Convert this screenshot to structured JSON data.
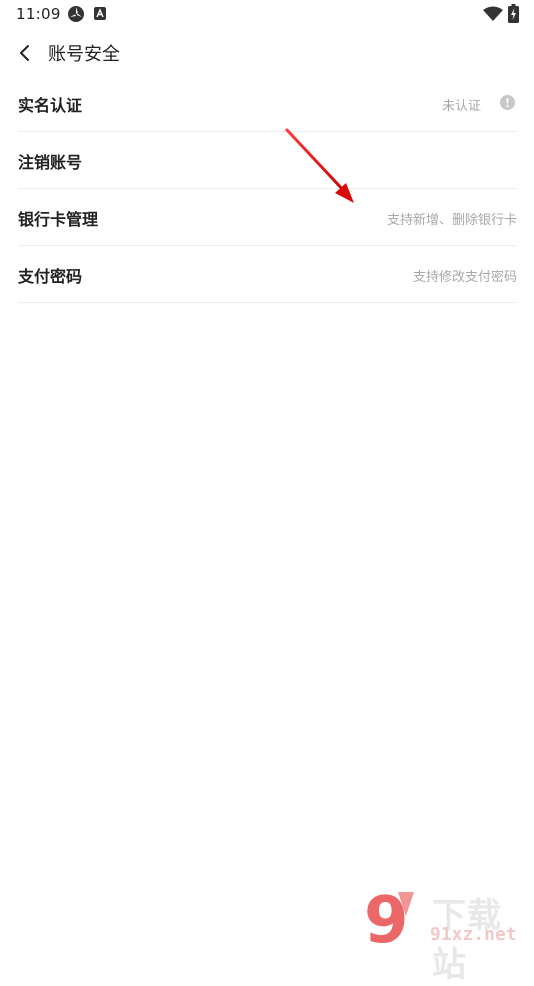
{
  "status_bar": {
    "time": "11:09",
    "icons": [
      "radar-icon",
      "a-notification-icon",
      "wifi-icon",
      "battery-charging-icon"
    ]
  },
  "nav": {
    "back_icon": "chevron-left-icon",
    "title": "账号安全"
  },
  "menu": [
    {
      "label": "实名认证",
      "hint": "未认证",
      "icon": "info-circle-icon"
    },
    {
      "label": "注销账号",
      "hint": ""
    },
    {
      "label": "银行卡管理",
      "hint": "支持新增、删除银行卡"
    },
    {
      "label": "支付密码",
      "hint": "支持修改支付密码"
    }
  ],
  "annotation": {
    "color": "#e02020",
    "icon": "red-arrow-annotation"
  },
  "watermark": {
    "logo_text": "9",
    "cn_text": "下载站",
    "en_text": "91xz.net",
    "colors": {
      "logo": "#e94e4e",
      "cn": "#e8e8e8",
      "en": "#f2c9c9"
    }
  }
}
